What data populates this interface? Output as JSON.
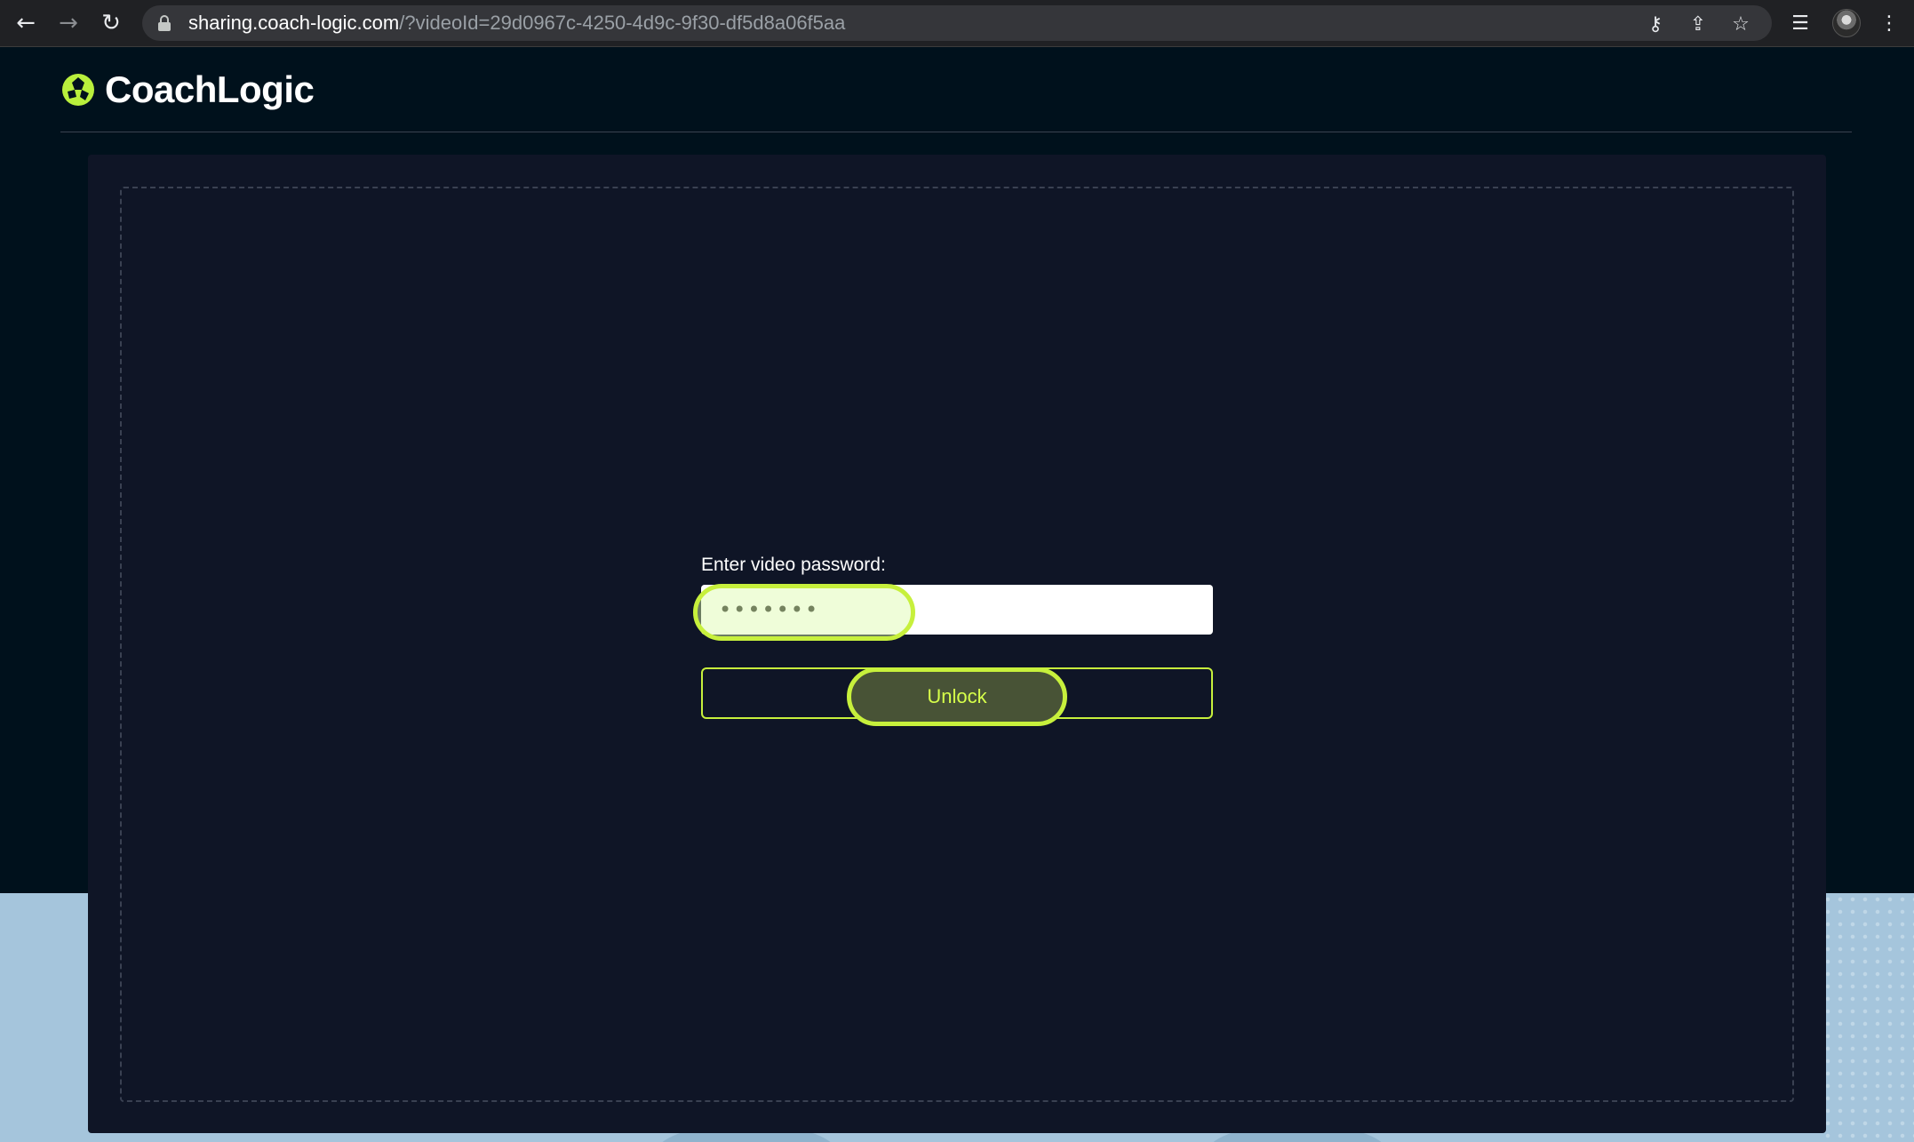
{
  "browser": {
    "url_host": "sharing.coach-logic.com",
    "url_path": "/?videoId=29d0967c-4250-4d9c-9f30-df5d8a06f5aa",
    "icons": {
      "back": "arrow-left",
      "forward": "arrow-right",
      "reload": "reload",
      "lock": "lock",
      "key": "key",
      "share": "share",
      "bookmark": "star",
      "reading_list": "reading-list",
      "menu": "vertical-dots"
    }
  },
  "header": {
    "logo_text": "CoachLogic"
  },
  "form": {
    "label": "Enter video password:",
    "password_value": "*******",
    "unlock_label": "Unlock"
  },
  "colors": {
    "accent": "#c7f03c",
    "page_background": "#00111c",
    "panel_background": "#0f1526",
    "lower_background": "#a5c5dc"
  }
}
